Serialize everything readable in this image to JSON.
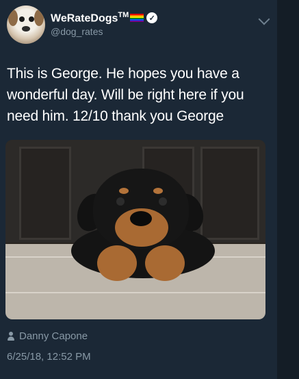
{
  "account": {
    "display_name": "WeRateDogs",
    "trademark": "TM",
    "handle": "@dog_rates"
  },
  "tweet": {
    "text": "This is George. He hopes you have a wonderful day. Will be right here if you need him. 12/10 thank you George",
    "photo_credit": "Danny Capone",
    "timestamp": "6/25/18, 12:52 PM"
  },
  "icons": {
    "verified": "verified-badge-icon",
    "flag": "rainbow-flag-icon",
    "menu": "chevron-down-icon",
    "credit": "person-icon"
  },
  "colors": {
    "background": "#1b2836",
    "secondary_text": "#8899a6"
  }
}
